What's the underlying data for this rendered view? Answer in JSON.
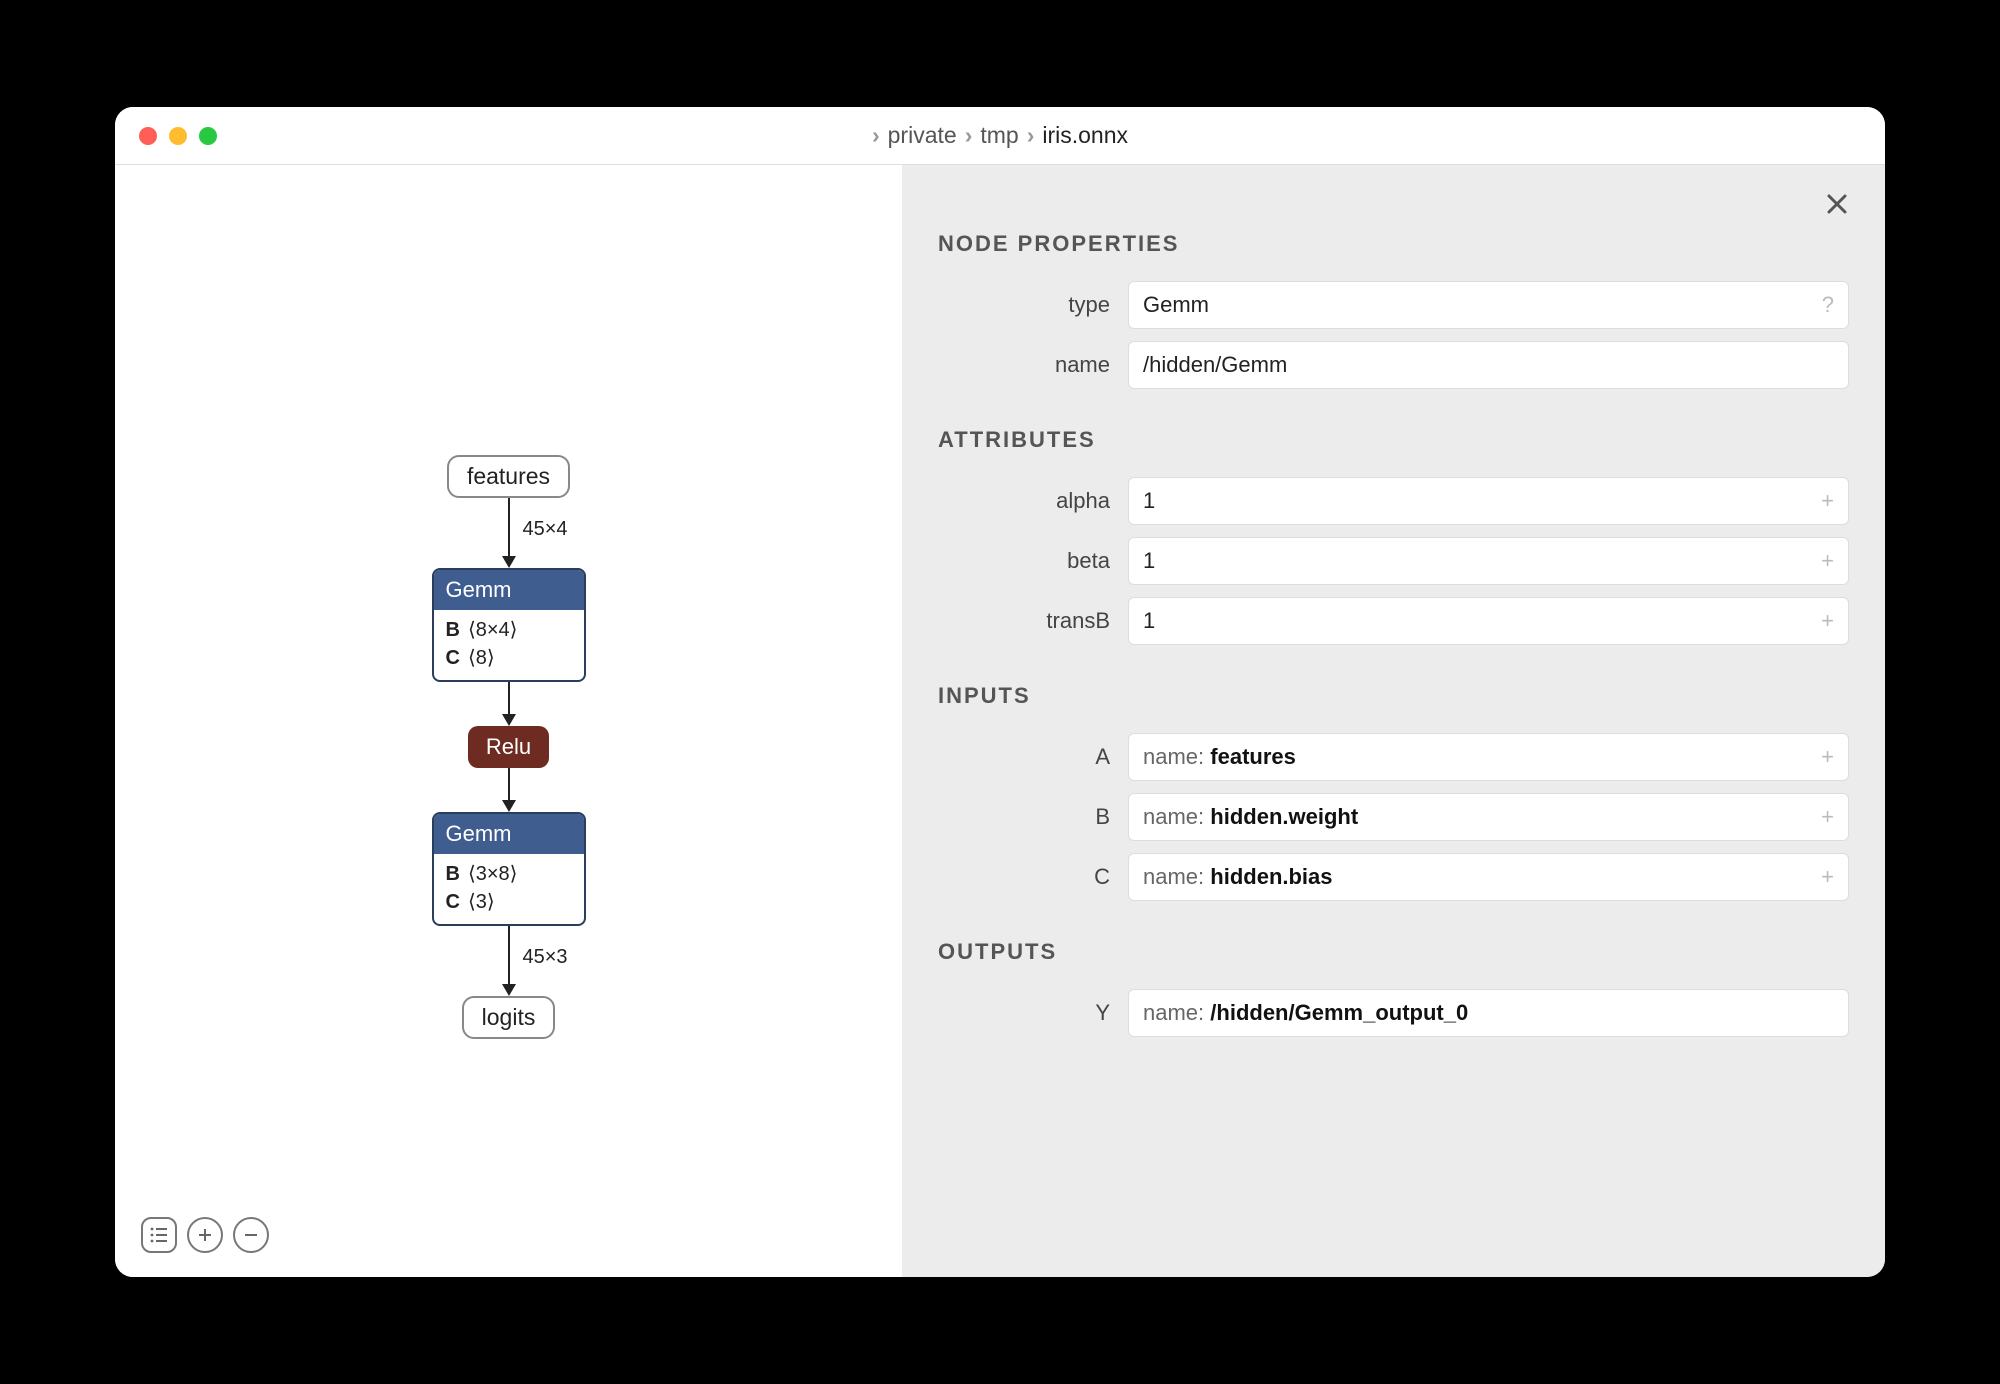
{
  "breadcrumb": [
    "private",
    "tmp",
    "iris.onnx"
  ],
  "graph": {
    "input_pill": "features",
    "edge1_label": "45×4",
    "gemm1": {
      "title": "Gemm",
      "rows": [
        {
          "k": "B",
          "v": "⟨8×4⟩"
        },
        {
          "k": "C",
          "v": "⟨8⟩"
        }
      ]
    },
    "relu_label": "Relu",
    "gemm2": {
      "title": "Gemm",
      "rows": [
        {
          "k": "B",
          "v": "⟨3×8⟩"
        },
        {
          "k": "C",
          "v": "⟨3⟩"
        }
      ]
    },
    "edge3_label": "45×3",
    "output_pill": "logits"
  },
  "sidebar": {
    "title_node_props": "NODE PROPERTIES",
    "type_label": "type",
    "type_value": "Gemm",
    "type_suffix": "?",
    "name_label": "name",
    "name_value": "/hidden/Gemm",
    "title_attrs": "ATTRIBUTES",
    "attrs": [
      {
        "label": "alpha",
        "value": "1",
        "suffix": "+"
      },
      {
        "label": "beta",
        "value": "1",
        "suffix": "+"
      },
      {
        "label": "transB",
        "value": "1",
        "suffix": "+"
      }
    ],
    "title_inputs": "INPUTS",
    "inputs": [
      {
        "label": "A",
        "key": "name:",
        "val": "features",
        "suffix": "+"
      },
      {
        "label": "B",
        "key": "name:",
        "val": "hidden.weight",
        "suffix": "+"
      },
      {
        "label": "C",
        "key": "name:",
        "val": "hidden.bias",
        "suffix": "+"
      }
    ],
    "title_outputs": "OUTPUTS",
    "outputs": [
      {
        "label": "Y",
        "key": "name:",
        "val": "/hidden/Gemm_output_0"
      }
    ]
  }
}
